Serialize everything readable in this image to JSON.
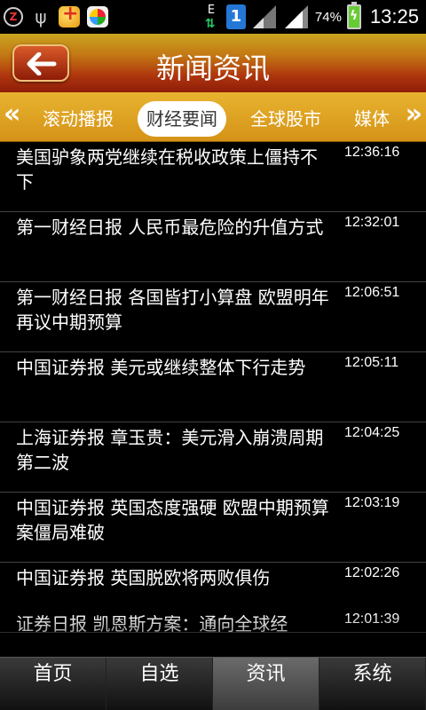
{
  "status_bar": {
    "icons": [
      "z-app-icon",
      "usb-icon",
      "health-app-icon",
      "color-app-icon",
      "data-transfer-icon",
      "sim-icon",
      "wifi-signal-icon",
      "cell-signal-icon",
      "battery-charging-icon"
    ],
    "e_label": "E",
    "sim_label": "1",
    "battery_percent": "74%",
    "battery_level": 0.74,
    "time": "13:25"
  },
  "header": {
    "title": "新闻资讯",
    "back_icon": "back-arrow-icon"
  },
  "tabs": {
    "items": [
      {
        "label": "滚动播报"
      },
      {
        "label": "财经要闻"
      },
      {
        "label": "全球股市"
      },
      {
        "label": "媒体"
      }
    ],
    "selected_index": 1,
    "left_arrow": "«",
    "right_arrow": "»"
  },
  "news": [
    {
      "title": "美国驴象两党继续在税收政策上僵持不下",
      "time": "12:36:16"
    },
    {
      "title": "第一财经日报 人民币最危险的升值方式",
      "time": "12:32:01"
    },
    {
      "title": "第一财经日报 各国皆打小算盘 欧盟明年再议中期预算",
      "time": "12:06:51"
    },
    {
      "title": "中国证券报 美元或继续整体下行走势",
      "time": "12:05:11"
    },
    {
      "title": "上海证券报 章玉贵：美元滑入崩溃周期第二波",
      "time": "12:04:25"
    },
    {
      "title": "中国证券报 英国态度强硬 欧盟中期预算案僵局难破",
      "time": "12:03:19"
    },
    {
      "title": "中国证券报 英国脱欧将两败俱伤",
      "time": "12:02:26"
    },
    {
      "title": "证券日报 凯恩斯方案：通向全球经",
      "time": "12:01:39"
    }
  ],
  "bottom_nav": {
    "items": [
      {
        "label": "首页"
      },
      {
        "label": "自选"
      },
      {
        "label": "资讯"
      },
      {
        "label": "系统"
      }
    ],
    "active_index": 2
  },
  "colors": {
    "header_gradient_top": "#c9a420",
    "header_gradient_bottom": "#8e1c08",
    "tab_bar": "#e0a626",
    "list_background": "#000000",
    "selected_tab_bg": "#ffffff"
  }
}
